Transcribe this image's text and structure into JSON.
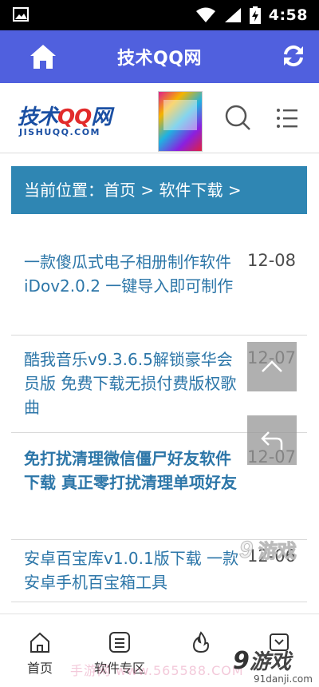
{
  "status_bar": {
    "time": "4:58",
    "icons": [
      "image-icon",
      "wifi-icon",
      "signal-icon",
      "battery-charging-icon"
    ]
  },
  "app_bar": {
    "title": "技术QQ网",
    "left_icon": "home-icon",
    "right_icon": "refresh-icon",
    "background": "#5060de"
  },
  "site_header": {
    "logo_main_prefix": "技术",
    "logo_main_qq": "QQ",
    "logo_main_suffix": "网",
    "logo_sub": "JISHUQQ.COM",
    "search_icon": "search-icon",
    "menu_icon": "list-menu-icon"
  },
  "breadcrumb": {
    "text": "当前位置：首页 > 软件下载 >",
    "background": "#2f86b3"
  },
  "articles": [
    {
      "title": "一款傻瓜式电子相册制作软件iDov2.0.2 一键导入即可制作",
      "date": "12-08",
      "bold": false
    },
    {
      "title": "酷我音乐v9.3.6.5解锁豪华会员版 免费下载无损付费版权歌曲",
      "date": "12-07",
      "bold": false
    },
    {
      "title": "免打扰清理微信僵尸好友软件下载 真正零打扰清理单项好友",
      "date": "12-07",
      "bold": true
    },
    {
      "title": "安卓百宝库v1.0.1版下载 一款安卓手机百宝箱工具",
      "date": "12-06",
      "bold": false
    }
  ],
  "floating_buttons": {
    "scroll_top_icon": "chevron-up-icon",
    "back_icon": "back-arrow-icon"
  },
  "bottom_nav": [
    {
      "label": "首页",
      "icon": "home-outline-icon"
    },
    {
      "label": "软件专区",
      "icon": "list-box-icon"
    },
    {
      "label": "",
      "icon": "flame-icon"
    },
    {
      "label": "",
      "icon": "archive-icon"
    }
  ],
  "watermarks": {
    "logo_text": "游戏",
    "logo_num": "9",
    "url": "91danji.com",
    "faded_text": "手游网 www.565588.COM"
  }
}
